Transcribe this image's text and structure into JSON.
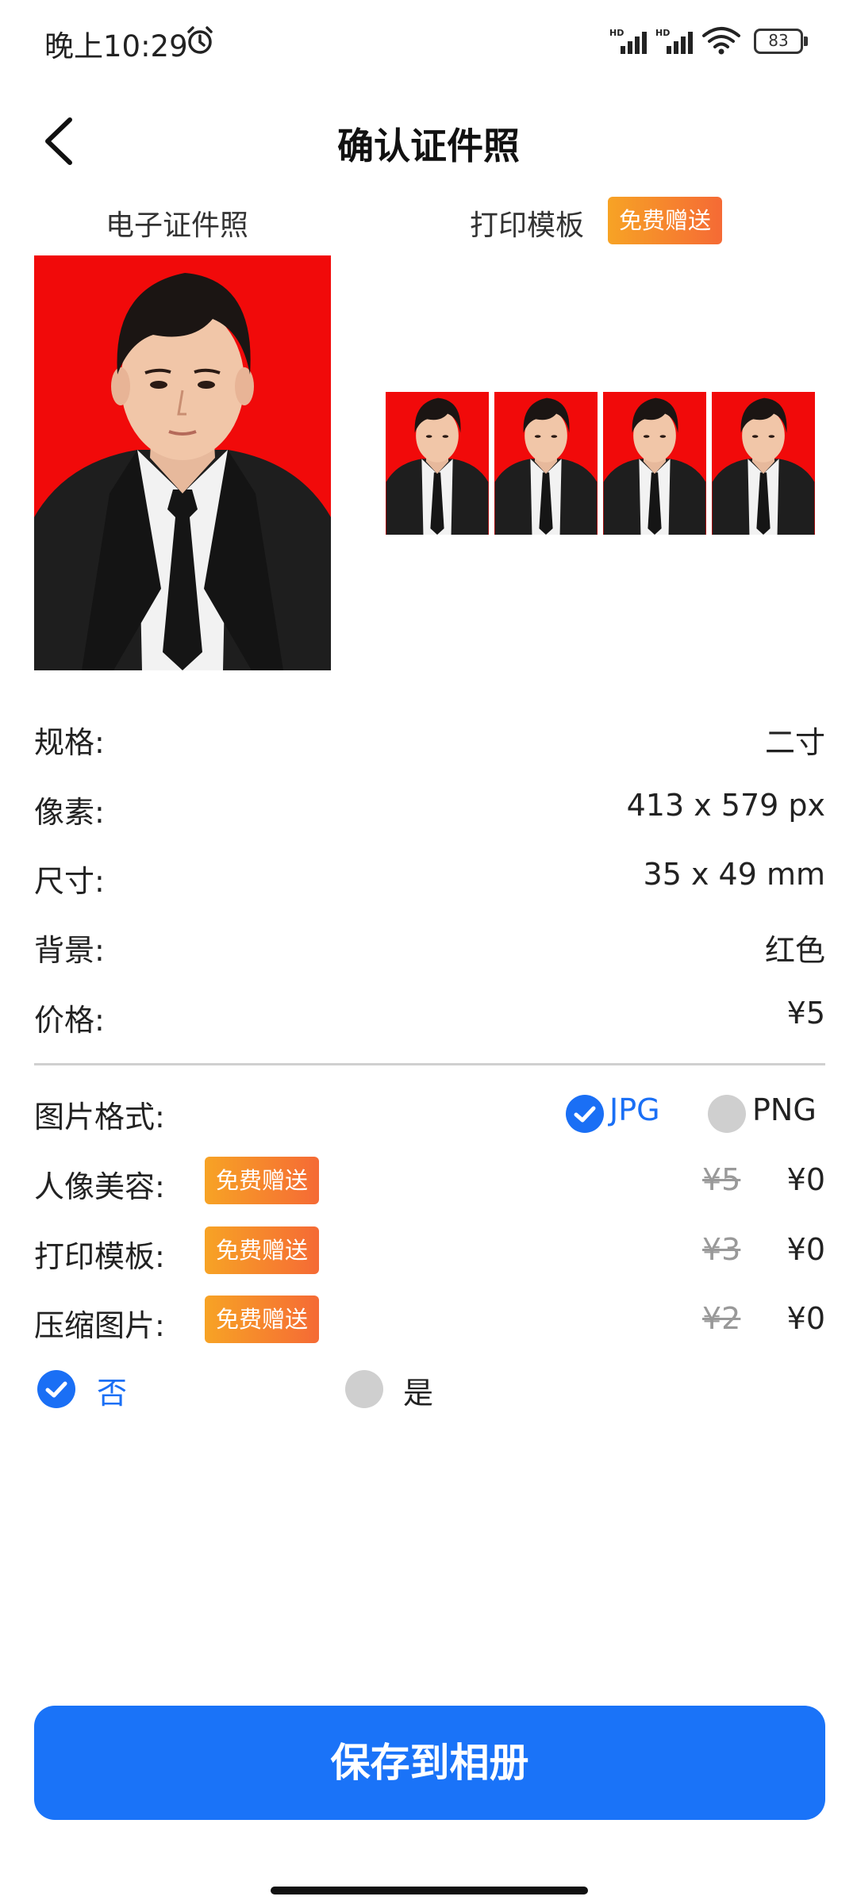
{
  "status_bar": {
    "time": "晚上10:29",
    "signal_label": "HD",
    "battery": "83",
    "icons": [
      "alarm-icon",
      "signal-icon",
      "signal-icon",
      "wifi-icon",
      "battery-icon"
    ]
  },
  "header": {
    "title": "确认证件照",
    "back_icon": "chevron-left-icon"
  },
  "preview": {
    "digital_label": "电子证件照",
    "print_label": "打印模板",
    "print_badge": "免费赠送"
  },
  "specs": [
    {
      "label": "规格:",
      "value": "二寸"
    },
    {
      "label": "像素:",
      "value": "413 x 579 px"
    },
    {
      "label": "尺寸:",
      "value": "35 x 49 mm"
    },
    {
      "label": "背景:",
      "value": "红色"
    },
    {
      "label": "价格:",
      "value": "¥5"
    }
  ],
  "format": {
    "label": "图片格式:",
    "options": [
      {
        "label": "JPG",
        "selected": true
      },
      {
        "label": "PNG",
        "selected": false
      }
    ]
  },
  "addons": [
    {
      "label": "人像美容:",
      "badge": "免费赠送",
      "old_price": "¥5",
      "price": "¥0"
    },
    {
      "label": "打印模板:",
      "badge": "免费赠送",
      "old_price": "¥3",
      "price": "¥0"
    },
    {
      "label": "压缩图片:",
      "badge": "免费赠送",
      "old_price": "¥2",
      "price": "¥0"
    }
  ],
  "compress_choice": {
    "options": [
      {
        "label": "否",
        "selected": true
      },
      {
        "label": "是",
        "selected": false
      }
    ]
  },
  "save_button": "保存到相册",
  "colors": {
    "accent": "#1a73f8",
    "photo_background": "#f10a0a",
    "badge_start": "#f7a325",
    "badge_end": "#f56a35"
  }
}
